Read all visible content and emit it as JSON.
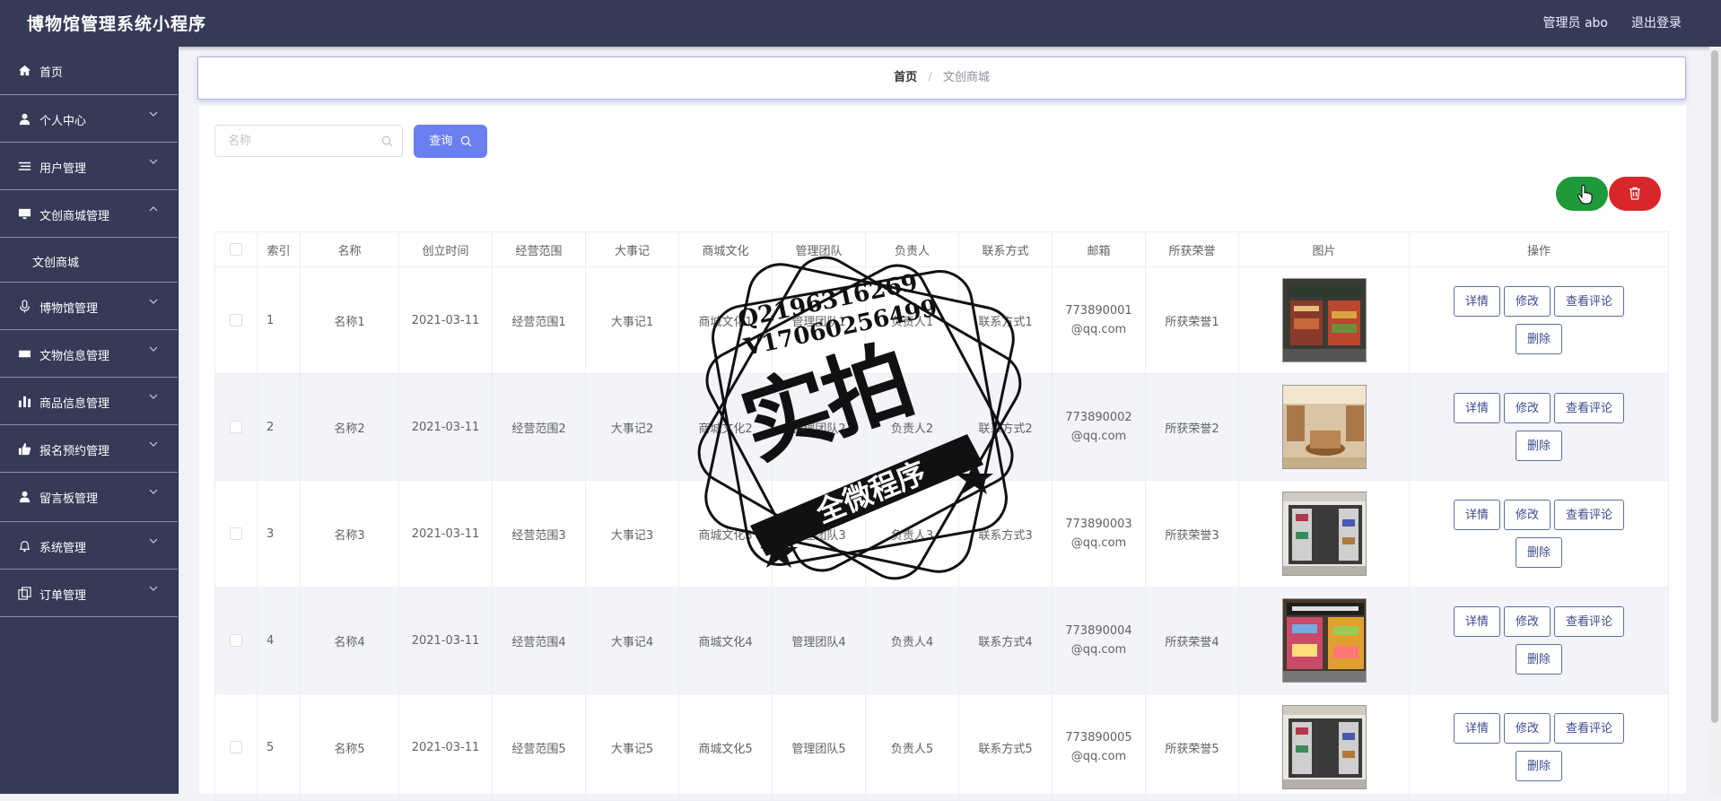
{
  "app": {
    "title": "博物馆管理系统小程序",
    "user_label": "管理员 abo",
    "logout": "退出登录"
  },
  "sidebar": {
    "items": [
      {
        "label": "首页",
        "icon": "home-icon"
      },
      {
        "label": "个人中心",
        "icon": "user-icon"
      },
      {
        "label": "用户管理",
        "icon": "list-icon"
      },
      {
        "label": "文创商城管理",
        "icon": "monitor-icon",
        "expanded": true
      },
      {
        "label": "博物馆管理",
        "icon": "microphone-icon"
      },
      {
        "label": "文物信息管理",
        "icon": "ticket-icon"
      },
      {
        "label": "商品信息管理",
        "icon": "chart-icon"
      },
      {
        "label": "报名预约管理",
        "icon": "thumb-icon"
      },
      {
        "label": "留言板管理",
        "icon": "user-icon"
      },
      {
        "label": "系统管理",
        "icon": "bell-icon"
      },
      {
        "label": "订单管理",
        "icon": "copy-icon"
      }
    ],
    "submenu": {
      "label": "文创商城"
    }
  },
  "breadcrumb": {
    "home": "首页",
    "separator": "/",
    "current": "文创商城"
  },
  "search": {
    "placeholder": "名称",
    "value": "",
    "button": "查询"
  },
  "table": {
    "headers": [
      "索引",
      "名称",
      "创立时间",
      "经营范围",
      "大事记",
      "商城文化",
      "管理团队",
      "负责人",
      "联系方式",
      "邮箱",
      "所获荣誉",
      "图片",
      "操作"
    ],
    "rows": [
      {
        "index": "1",
        "name": "名称1",
        "date": "2021-03-11",
        "scope": "经营范围1",
        "events": "大事记1",
        "culture": "商城文化1",
        "team": "管理团队1",
        "owner": "负责人1",
        "contact": "联系方式1",
        "email_a": "773890001",
        "email_b": "@qq.com",
        "honor": "所获荣誉1",
        "image": "storefront-photo"
      },
      {
        "index": "2",
        "name": "名称2",
        "date": "2021-03-11",
        "scope": "经营范围2",
        "events": "大事记2",
        "culture": "商城文化2",
        "team": "管理团队2",
        "owner": "负责人2",
        "contact": "联系方式2",
        "email_a": "773890002",
        "email_b": "@qq.com",
        "honor": "所获荣誉2",
        "image": "shop-interior-photo"
      },
      {
        "index": "3",
        "name": "名称3",
        "date": "2021-03-11",
        "scope": "经营范围3",
        "events": "大事记3",
        "culture": "商城文化3",
        "team": "管理团队3",
        "owner": "负责人3",
        "contact": "联系方式3",
        "email_a": "773890003",
        "email_b": "@qq.com",
        "honor": "所获荣誉3",
        "image": "display-window-photo"
      },
      {
        "index": "4",
        "name": "名称4",
        "date": "2021-03-11",
        "scope": "经营范围4",
        "events": "大事记4",
        "culture": "商城文化4",
        "team": "管理团队4",
        "owner": "负责人4",
        "contact": "联系方式4",
        "email_a": "773890004",
        "email_b": "@qq.com",
        "honor": "所获荣誉4",
        "image": "store-sign-photo"
      },
      {
        "index": "5",
        "name": "名称5",
        "date": "2021-03-11",
        "scope": "经营范围5",
        "events": "大事记5",
        "culture": "商城文化5",
        "team": "管理团队5",
        "owner": "负责人5",
        "contact": "联系方式5",
        "email_a": "773890005",
        "email_b": "@qq.com",
        "honor": "所获荣誉5",
        "image": "display-window-photo"
      }
    ],
    "actions": {
      "detail": "详情",
      "edit": "修改",
      "comments": "查看评论",
      "delete": "删除"
    }
  },
  "watermark": {
    "line1": "Q2196316269",
    "line2": "V17060256499",
    "big": "实拍",
    "ribbon": "全微程序"
  },
  "colors": {
    "sidebar_bg": "#353a57",
    "primary": "#6b7ff0",
    "success": "#1e9a3a",
    "danger": "#d9262b"
  }
}
